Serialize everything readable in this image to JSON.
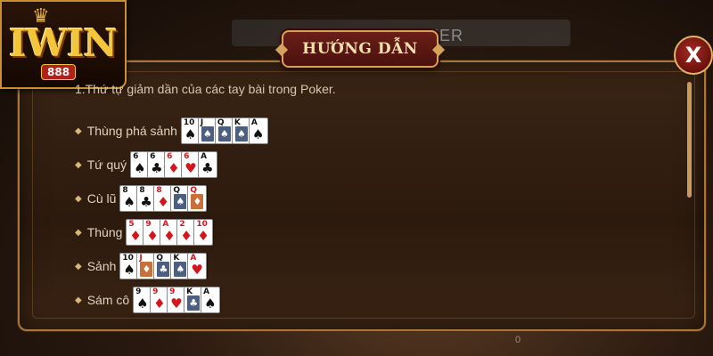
{
  "background": {
    "hint_text": "KER"
  },
  "logo": {
    "text": "IWIN",
    "sub": "888"
  },
  "dialog": {
    "title": "HƯỚNG DẪN",
    "close_label": "X",
    "intro": "1.Thứ tự giảm dần của các tay bài trong Poker.",
    "hands": [
      {
        "name": "Thùng phá sảnh",
        "cards": [
          {
            "rank": "10",
            "suit": "♠",
            "color": "black",
            "face": false
          },
          {
            "rank": "J",
            "suit": "♠",
            "color": "black",
            "face": true
          },
          {
            "rank": "Q",
            "suit": "♠",
            "color": "black",
            "face": true
          },
          {
            "rank": "K",
            "suit": "♠",
            "color": "black",
            "face": true
          },
          {
            "rank": "A",
            "suit": "♠",
            "color": "black",
            "face": false
          }
        ]
      },
      {
        "name": "Tứ quý",
        "cards": [
          {
            "rank": "6",
            "suit": "♠",
            "color": "black",
            "face": false
          },
          {
            "rank": "6",
            "suit": "♣",
            "color": "black",
            "face": false
          },
          {
            "rank": "6",
            "suit": "♦",
            "color": "red",
            "face": false
          },
          {
            "rank": "6",
            "suit": "♥",
            "color": "red",
            "face": false
          },
          {
            "rank": "A",
            "suit": "♣",
            "color": "black",
            "face": false
          }
        ]
      },
      {
        "name": "Cù lũ",
        "cards": [
          {
            "rank": "8",
            "suit": "♠",
            "color": "black",
            "face": false
          },
          {
            "rank": "8",
            "suit": "♣",
            "color": "black",
            "face": false
          },
          {
            "rank": "8",
            "suit": "♦",
            "color": "red",
            "face": false
          },
          {
            "rank": "Q",
            "suit": "♠",
            "color": "black",
            "face": true
          },
          {
            "rank": "Q",
            "suit": "♦",
            "color": "red",
            "face": true
          }
        ]
      },
      {
        "name": "Thùng",
        "cards": [
          {
            "rank": "5",
            "suit": "♦",
            "color": "red",
            "face": false
          },
          {
            "rank": "9",
            "suit": "♦",
            "color": "red",
            "face": false
          },
          {
            "rank": "A",
            "suit": "♦",
            "color": "red",
            "face": false
          },
          {
            "rank": "2",
            "suit": "♦",
            "color": "red",
            "face": false
          },
          {
            "rank": "10",
            "suit": "♦",
            "color": "red",
            "face": false
          }
        ]
      },
      {
        "name": "Sảnh",
        "cards": [
          {
            "rank": "10",
            "suit": "♠",
            "color": "black",
            "face": false
          },
          {
            "rank": "J",
            "suit": "♦",
            "color": "red",
            "face": true
          },
          {
            "rank": "Q",
            "suit": "♣",
            "color": "black",
            "face": true
          },
          {
            "rank": "K",
            "suit": "♠",
            "color": "black",
            "face": true
          },
          {
            "rank": "A",
            "suit": "♥",
            "color": "red",
            "face": false
          }
        ]
      },
      {
        "name": "Sám cô",
        "cards": [
          {
            "rank": "9",
            "suit": "♠",
            "color": "black",
            "face": false
          },
          {
            "rank": "9",
            "suit": "♦",
            "color": "red",
            "face": false
          },
          {
            "rank": "9",
            "suit": "♥",
            "color": "red",
            "face": false
          },
          {
            "rank": "K",
            "suit": "♣",
            "color": "black",
            "face": true
          },
          {
            "rank": "A",
            "suit": "♠",
            "color": "black",
            "face": false
          }
        ]
      }
    ]
  },
  "footer": {
    "hint": "0"
  },
  "colors": {
    "accent_gold": "#d4a25a",
    "banner_red": "#6b1e18",
    "card_red": "#d4151c"
  }
}
